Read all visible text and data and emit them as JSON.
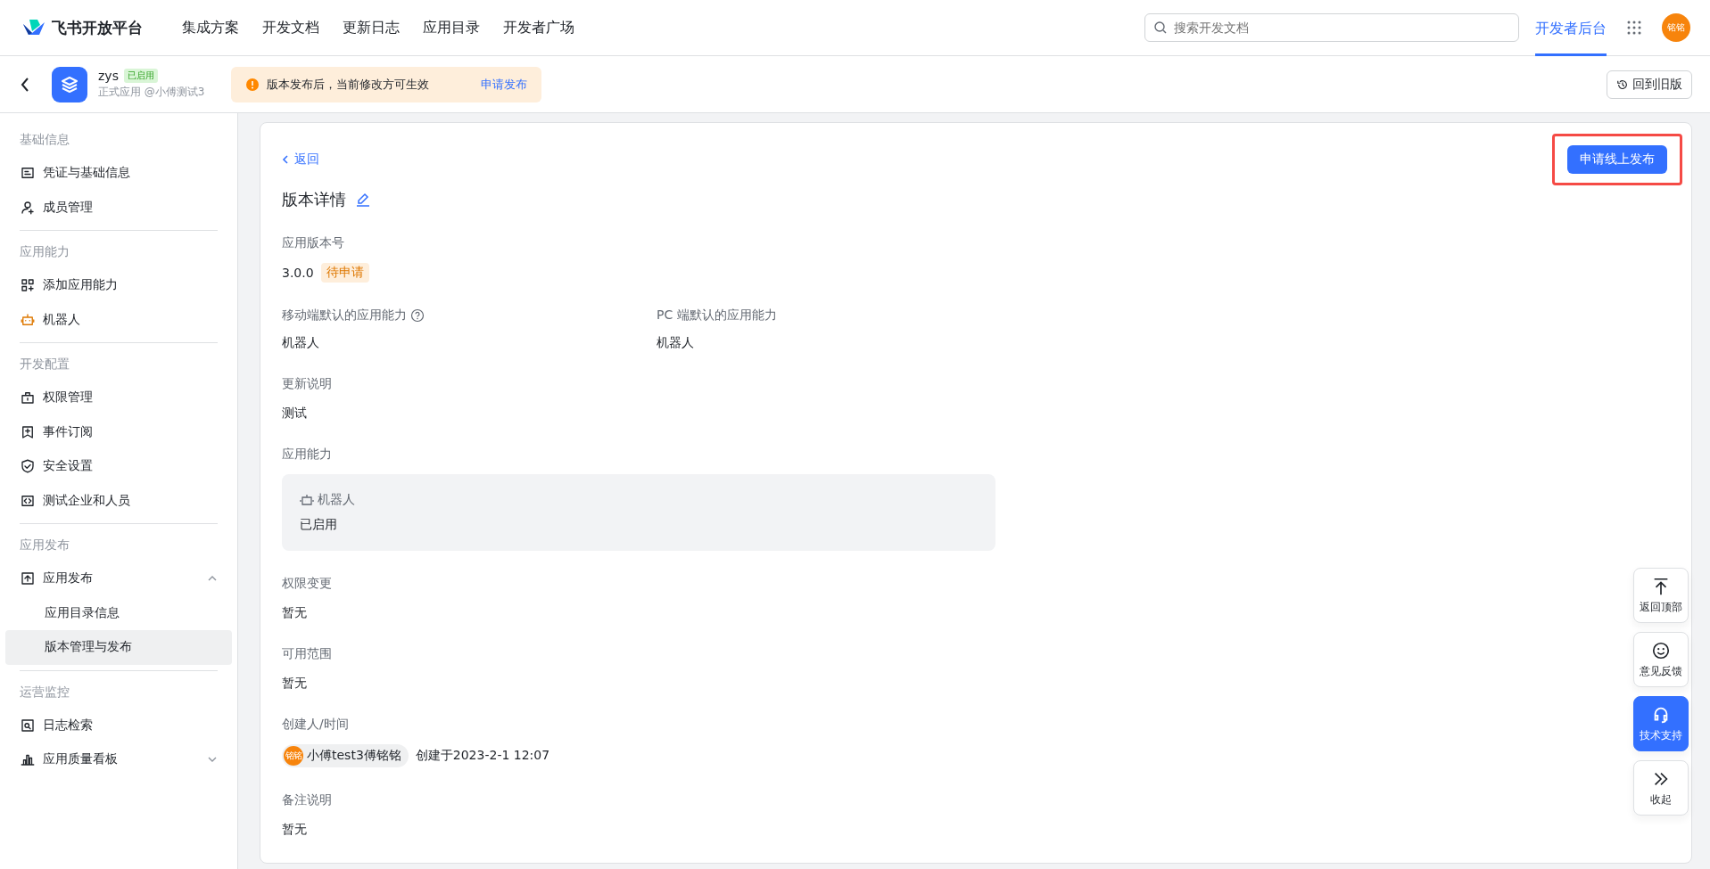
{
  "header": {
    "logo": "飞书开放平台",
    "nav": [
      {
        "label": "集成方案"
      },
      {
        "label": "开发文档"
      },
      {
        "label": "更新日志"
      },
      {
        "label": "应用目录"
      },
      {
        "label": "开发者广场"
      }
    ],
    "search": {
      "placeholder": "搜索开发文档"
    },
    "console": {
      "label": "开发者后台",
      "selected": true
    },
    "avatar": "铭铭"
  },
  "app_bar": {
    "name": "zys",
    "status": "已启用",
    "subtitle": "正式应用 @小傅测试3",
    "notice": "版本发布后，当前修改方可生效",
    "notice_link": "申请发布",
    "old_version": "回到旧版"
  },
  "sidebar": {
    "groups": [
      {
        "label": "基础信息",
        "items": [
          {
            "label": "凭证与基础信息",
            "selected": false
          },
          {
            "label": "成员管理",
            "selected": false
          }
        ]
      },
      {
        "label": "应用能力",
        "items": [
          {
            "label": "添加应用能力",
            "selected": false
          },
          {
            "label": "机器人",
            "selected": false
          }
        ]
      },
      {
        "label": "开发配置",
        "items": [
          {
            "label": "权限管理",
            "selected": false
          },
          {
            "label": "事件订阅",
            "selected": false
          },
          {
            "label": "安全设置",
            "selected": false
          },
          {
            "label": "测试企业和人员",
            "selected": false
          }
        ]
      },
      {
        "label": "应用发布",
        "items": [
          {
            "label": "应用发布",
            "selected": false,
            "expanded": true,
            "children": [
              {
                "label": "应用目录信息",
                "selected": false
              },
              {
                "label": "版本管理与发布",
                "selected": true
              }
            ]
          }
        ]
      },
      {
        "label": "运营监控",
        "items": [
          {
            "label": "日志检索",
            "selected": false
          },
          {
            "label": "应用质量看板",
            "selected": false,
            "expanded": false
          }
        ]
      }
    ]
  },
  "detail": {
    "back": "返回",
    "title": "版本详情",
    "publish_button": {
      "label": "申请线上发布",
      "highlighted": true
    },
    "sections": [
      {
        "kind": "version",
        "label": "应用版本号",
        "value": "3.0.0",
        "badge": "待申请"
      },
      {
        "kind": "pair",
        "columns": [
          {
            "label": "移动端默认的应用能力",
            "help": true,
            "value": "机器人"
          },
          {
            "label": "PC 端默认的应用能力",
            "value": "机器人"
          }
        ]
      },
      {
        "kind": "text",
        "label": "更新说明",
        "value": "测试"
      },
      {
        "kind": "card",
        "label": "应用能力",
        "card_title": "机器人",
        "card_value": "已启用"
      },
      {
        "kind": "text",
        "label": "权限变更",
        "value": "暂无"
      },
      {
        "kind": "text",
        "label": "可用范围",
        "value": "暂无"
      },
      {
        "kind": "creator",
        "label": "创建人/时间",
        "avatar": "铭铭",
        "user": "小傅test3傅铭铭",
        "value": "创建于2023-2-1 12:07"
      },
      {
        "kind": "text",
        "label": "备注说明",
        "value": "暂无"
      }
    ]
  },
  "float_buttons": [
    {
      "label": "返回顶部",
      "selected": false
    },
    {
      "label": "意见反馈",
      "selected": false
    },
    {
      "label": "技术支持",
      "selected": true
    },
    {
      "label": "收起",
      "selected": false
    }
  ]
}
